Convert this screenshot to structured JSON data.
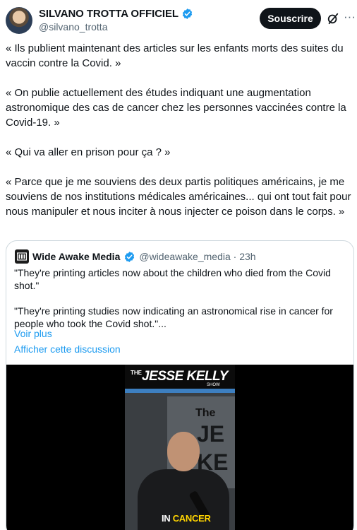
{
  "author": {
    "display_name": "SILVANO TROTTA OFFICIEL",
    "handle": "@silvano_trotta",
    "verified_color": "#1d9bf0"
  },
  "actions": {
    "subscribe_label": "Souscrire",
    "grok_icon": "grok-icon",
    "more_icon": "more-icon"
  },
  "tweet": {
    "paragraphs": [
      "« Ils publient maintenant des articles sur les enfants morts des suites du vaccin contre la Covid. »",
      "« On publie actuellement des études indiquant une augmentation astronomique des cas de cancer chez les personnes vaccinées contre la Covid-19. »",
      "« Qui va aller en prison pour ça ? »",
      "« Parce que je me souviens des deux partis politiques américains, je me souviens de nos institutions médicales américaines... qui ont tout fait pour nous manipuler et nous inciter à nous injecter ce poison dans le corps. »"
    ]
  },
  "quote": {
    "name": "Wide Awake Media",
    "meta": "@wideawake_media · 23h",
    "paragraphs": [
      "\"They're printing articles now about the children who died from the Covid shot.\"",
      "\"They're printing studies now indicating an astronomical rise in cancer for people who took the Covid shot.\"..."
    ],
    "show_more": "Voir plus",
    "show_thread": "Afficher cette discussion",
    "media": {
      "banner_the": "THE",
      "banner_title": "JESSE KELLY",
      "banner_show": "SHOW",
      "set_the": "The",
      "set_letters": "JE\nKE",
      "caption_prefix": "IN",
      "caption_highlight": "CANCER"
    }
  },
  "colors": {
    "accent": "#1d9bf0",
    "text": "#0f1419",
    "secondary": "#536471",
    "border": "#cfd9de"
  }
}
